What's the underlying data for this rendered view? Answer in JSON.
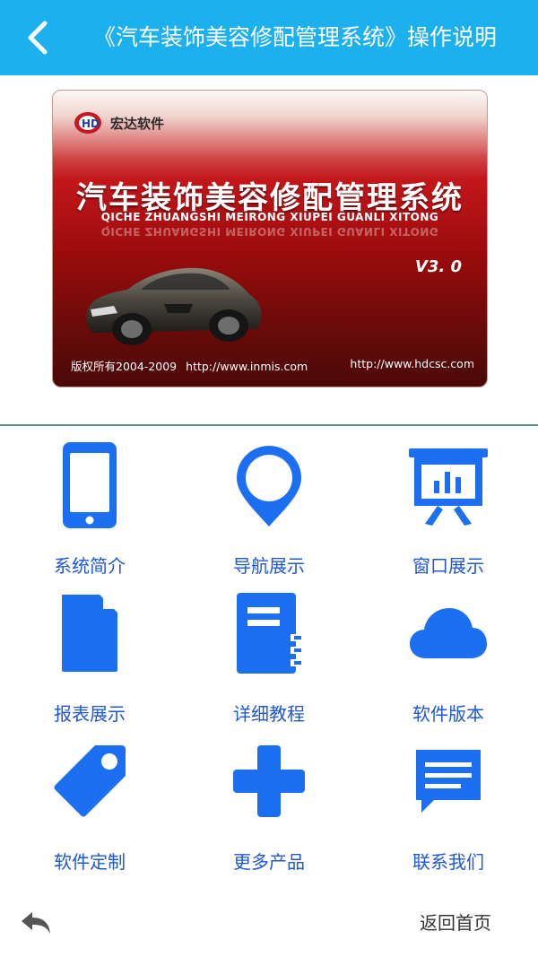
{
  "header": {
    "title": "《汽车装饰美容修配管理系统》操作说明",
    "bg_color": "#1cb0ee"
  },
  "banner": {
    "brand": "宏达软件",
    "title": "汽车装饰美容修配管理系统",
    "subtitle": "QICHE ZHUANGSHI MEIRONG XIUPEI GUANLI XITONG",
    "version": "V3. 0",
    "copyright": "版权所有2004-2009",
    "url1": "http://www.inmis.com",
    "url2": "http://www.hdcsc.com"
  },
  "menu": [
    {
      "label": "系统简介",
      "icon": "phone-icon"
    },
    {
      "label": "导航展示",
      "icon": "map-pin-icon"
    },
    {
      "label": "窗口展示",
      "icon": "presentation-chart-icon"
    },
    {
      "label": "报表展示",
      "icon": "document-icon"
    },
    {
      "label": "详细教程",
      "icon": "notebook-icon"
    },
    {
      "label": "软件版本",
      "icon": "cloud-icon"
    },
    {
      "label": "软件定制",
      "icon": "tag-icon"
    },
    {
      "label": "更多产品",
      "icon": "plus-icon"
    },
    {
      "label": "联系我们",
      "icon": "message-icon"
    }
  ],
  "accent_color": "#1b6ff0",
  "footer": {
    "home_label": "返回首页",
    "back_icon": "undo-arrow-icon"
  }
}
